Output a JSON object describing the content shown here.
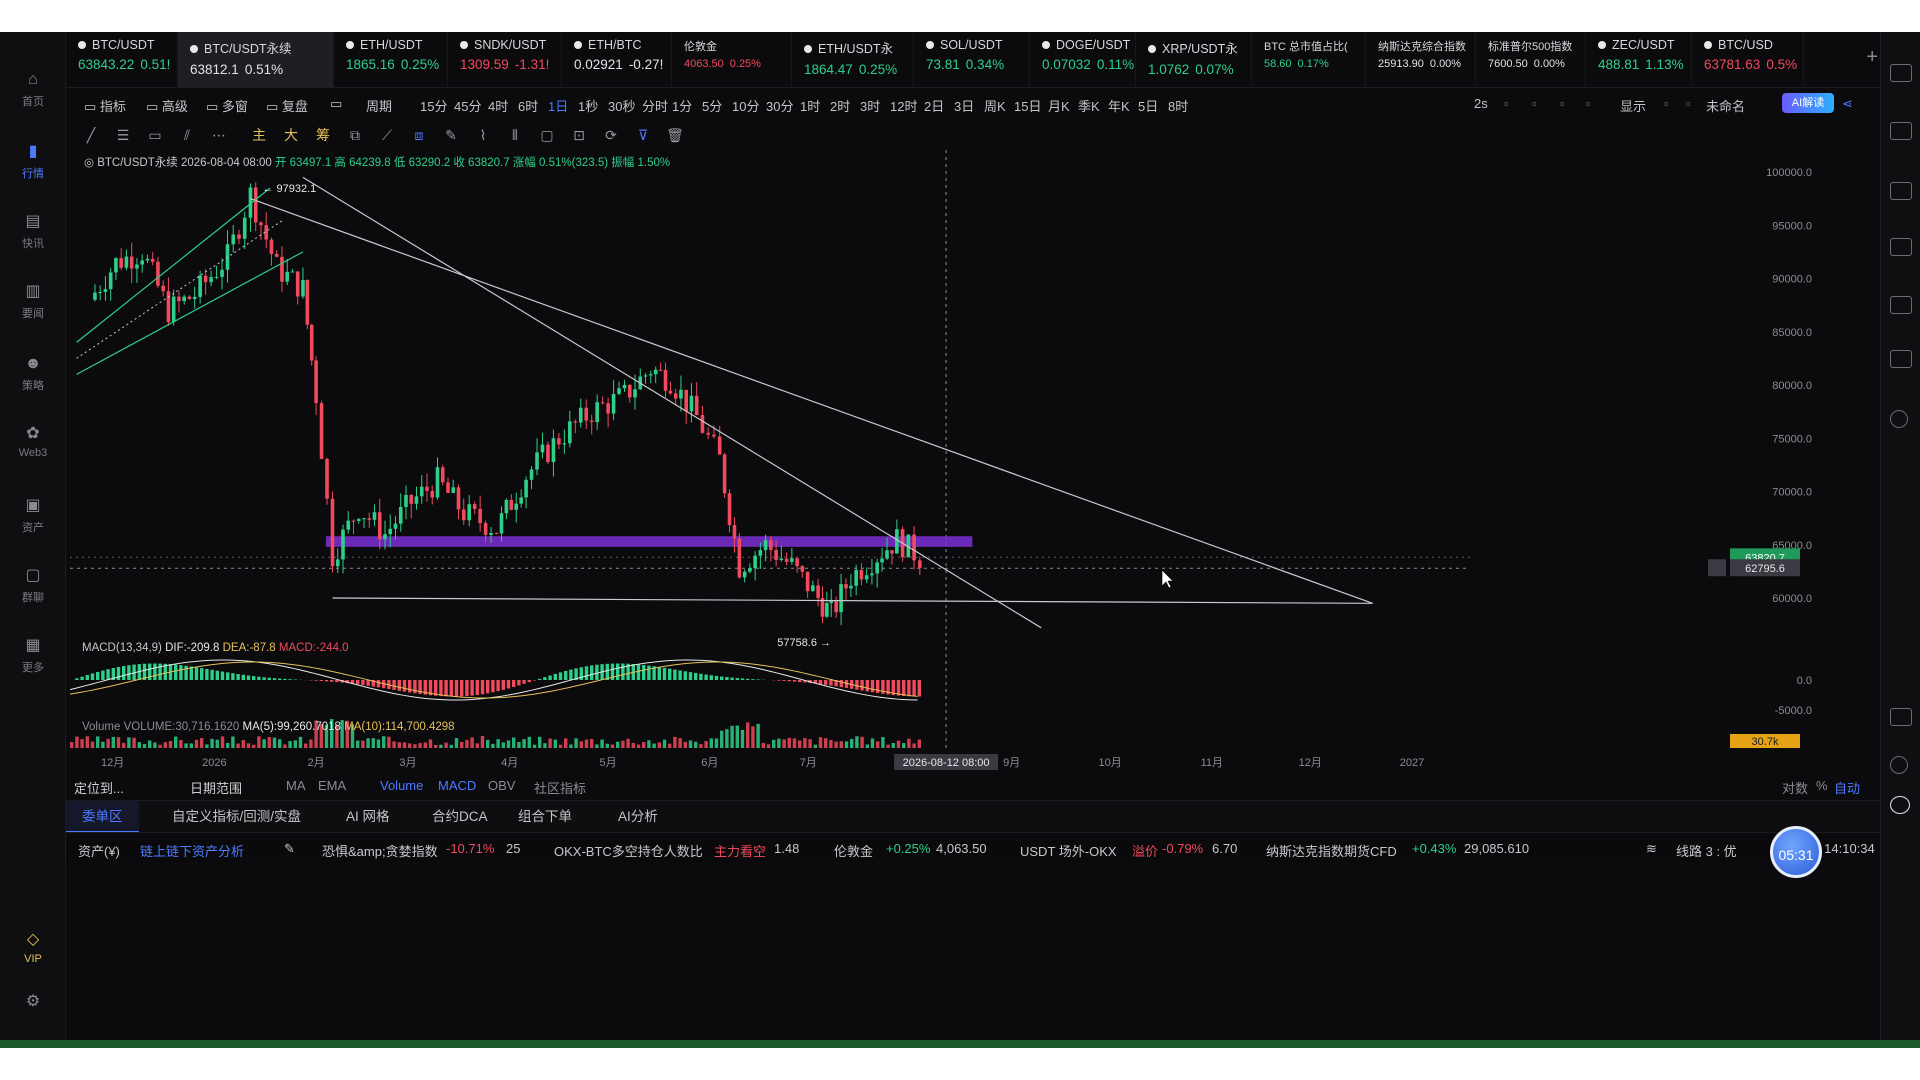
{
  "sidebar": {
    "items": [
      {
        "label": "首页",
        "icon": "home-icon"
      },
      {
        "label": "行情",
        "icon": "chart-bars-icon"
      },
      {
        "label": "快讯",
        "icon": "news-icon"
      },
      {
        "label": "要闻",
        "icon": "document-icon"
      },
      {
        "label": "策略",
        "icon": "robot-icon"
      },
      {
        "label": "Web3",
        "icon": "web3-icon"
      },
      {
        "label": "资产",
        "icon": "wallet-icon"
      },
      {
        "label": "群聊",
        "icon": "chat-icon"
      },
      {
        "label": "更多",
        "icon": "grid-icon"
      }
    ],
    "vip_label": "VIP",
    "settings_icon": "settings-icon"
  },
  "tickers": [
    {
      "name": "BTC/USDT",
      "price": "63843.22",
      "change": "0.51!",
      "dir": "up"
    },
    {
      "name": "BTC/USDT永续",
      "price": "63812.1",
      "change": "0.51%",
      "dir": "up",
      "selected": true
    },
    {
      "name": "ETH/USDT",
      "price": "1865.16",
      "change": "0.25%",
      "dir": "up"
    },
    {
      "name": "SNDK/USDT",
      "price": "1309.59",
      "change": "-1.31!",
      "dir": "dn"
    },
    {
      "name": "ETH/BTC",
      "price": "0.02921",
      "change": "-0.27!",
      "dir": "wh"
    },
    {
      "name": "伦敦金",
      "price": "4063.50",
      "change": "0.25%",
      "dir": "dn",
      "small": true
    },
    {
      "name": "ETH/USDT永",
      "price": "1864.47",
      "change": "0.25%",
      "dir": "up"
    },
    {
      "name": "SOL/USDT",
      "price": "73.81",
      "change": "0.34%",
      "dir": "up"
    },
    {
      "name": "DOGE/USDT",
      "price": "0.07032",
      "change": "0.11%",
      "dir": "up"
    },
    {
      "name": "XRP/USDT永",
      "price": "1.0762",
      "change": "0.07%",
      "dir": "up"
    },
    {
      "name": "BTC 总市值占比(",
      "price": "58.60",
      "change": "0.17%",
      "dir": "up",
      "small": true
    },
    {
      "name": "纳斯达克综合指数",
      "price": "25913.90",
      "change": "0.00%",
      "dir": "wh",
      "small": true
    },
    {
      "name": "标准普尔500指数",
      "price": "7600.50",
      "change": "0.00%",
      "dir": "wh",
      "small": true
    },
    {
      "name": "ZEC/USDT",
      "price": "488.81",
      "change": "1.13%",
      "dir": "up"
    },
    {
      "name": "BTC/USD",
      "price": "63781.63",
      "change": "0.5%",
      "dir": "dn"
    }
  ],
  "toolbar": {
    "left": [
      "指标",
      "高级",
      "多窗",
      "复盘",
      "",
      "周期"
    ],
    "periods": [
      "15分",
      "45分",
      "4时",
      "6时",
      "1日",
      "1秒",
      "30秒",
      "分时",
      "1分",
      "5分",
      "10分",
      "30分",
      "1时",
      "2时",
      "3时",
      "12时",
      "2日",
      "3日",
      "周K",
      "15日",
      "月K",
      "季K",
      "年K",
      "5日",
      "8时"
    ],
    "active_period": "1日",
    "right": [
      "2s",
      "显示",
      "未命名"
    ],
    "ai_label": "AI解读"
  },
  "drawbar": {
    "icons": [
      "trend-line-icon",
      "horizontal-lines-icon",
      "rectangle-icon",
      "pencil-icon",
      "more-icon",
      "main-icon",
      "big-icon",
      "chip-icon",
      "copy-icon",
      "measure-icon",
      "layers-icon",
      "eraser-icon",
      "brush-icon",
      "bars-icon",
      "clipboard-icon",
      "edit-icon",
      "rotate-icon",
      "filter-icon",
      "trash-icon"
    ],
    "text_items": [
      "主",
      "大",
      "筹"
    ]
  },
  "chart_info": {
    "symbol": "BTC/USDT永续",
    "date": "2026-08-04 08:00",
    "open": "开 63497.1",
    "high": "高 64239.8",
    "low": "低 63290.2",
    "close": "收 63820.7",
    "change": "涨幅 0.51%(323.5)",
    "amplitude": "振幅 1.50%"
  },
  "chart_data": {
    "type": "candlestick",
    "y_ticks": [
      "100000.0",
      "95000.0",
      "90000.0",
      "85000.0",
      "80000.0",
      "75000.0",
      "70000.0",
      "65000.0",
      "60000.0"
    ],
    "y_ticks_values": [
      100000,
      95000,
      90000,
      85000,
      80000,
      75000,
      70000,
      65000,
      60000
    ],
    "x_ticks": [
      "12月",
      "2026",
      "2月",
      "3月",
      "4月",
      "5月",
      "6月",
      "7月",
      "8月",
      "9月",
      "10月",
      "11月",
      "12月",
      "2027"
    ],
    "annotations": {
      "high": "97932.1",
      "low": "57758.6"
    },
    "last_price_label": "63820.7",
    "cursor_price_label": "62795.6",
    "cursor_date_label": "2026-08-12 08:00",
    "resistance_zone": [
      64800,
      65800
    ],
    "close_path": [
      {
        "t": "2025-11-24",
        "p": 88000
      },
      {
        "t": "2025-12-02",
        "p": 91500
      },
      {
        "t": "2025-12-10",
        "p": 92500
      },
      {
        "t": "2025-12-18",
        "p": 87000
      },
      {
        "t": "2025-12-26",
        "p": 88500
      },
      {
        "t": "2026-01-05",
        "p": 92000
      },
      {
        "t": "2026-01-12",
        "p": 97932
      },
      {
        "t": "2026-01-20",
        "p": 91000
      },
      {
        "t": "2026-01-28",
        "p": 89000
      },
      {
        "t": "2026-02-01",
        "p": 79000
      },
      {
        "t": "2026-02-06",
        "p": 64000
      },
      {
        "t": "2026-02-14",
        "p": 68500
      },
      {
        "t": "2026-02-22",
        "p": 66000
      },
      {
        "t": "2026-03-02",
        "p": 69000
      },
      {
        "t": "2026-03-10",
        "p": 71000
      },
      {
        "t": "2026-03-18",
        "p": 68000
      },
      {
        "t": "2026-03-28",
        "p": 66500
      },
      {
        "t": "2026-04-06",
        "p": 71500
      },
      {
        "t": "2026-04-16",
        "p": 75000
      },
      {
        "t": "2026-04-26",
        "p": 77500
      },
      {
        "t": "2026-05-06",
        "p": 79000
      },
      {
        "t": "2026-05-14",
        "p": 81500
      },
      {
        "t": "2026-05-20",
        "p": 80500
      },
      {
        "t": "2026-05-28",
        "p": 77000
      },
      {
        "t": "2026-06-04",
        "p": 73000
      },
      {
        "t": "2026-06-10",
        "p": 63000
      },
      {
        "t": "2026-06-18",
        "p": 65000
      },
      {
        "t": "2026-06-26",
        "p": 63000
      },
      {
        "t": "2026-07-04",
        "p": 60000
      },
      {
        "t": "2026-07-08",
        "p": 58500
      },
      {
        "t": "2026-07-14",
        "p": 62000
      },
      {
        "t": "2026-07-22",
        "p": 64000
      },
      {
        "t": "2026-07-28",
        "p": 65500
      },
      {
        "t": "2026-08-04",
        "p": 63820
      }
    ],
    "trendlines": [
      {
        "from": {
          "t": "2026-01-12",
          "p": 97500
        },
        "to": {
          "t": "2026-12-20",
          "p": 59500
        }
      },
      {
        "from": {
          "t": "2026-01-28",
          "p": 99500
        },
        "to": {
          "t": "2026-09-10",
          "p": 57200
        }
      },
      {
        "from": {
          "t": "2026-02-06",
          "p": 60000
        },
        "to": {
          "t": "2026-12-20",
          "p": 59500
        }
      },
      {
        "from": {
          "t": "2025-11-20",
          "p": 84000
        },
        "to": {
          "t": "2026-01-18",
          "p": 98500
        }
      },
      {
        "from": {
          "t": "2025-11-20",
          "p": 81000
        },
        "to": {
          "t": "2026-01-28",
          "p": 92500
        }
      }
    ],
    "macd": {
      "params": "MACD(13,34,9)",
      "dif": "DIF:-209.8",
      "dea": "DEA:-87.8",
      "macd": "MACD:-244.0",
      "y_ticks": [
        "0.0",
        "-5000.0"
      ]
    },
    "volume": {
      "label": "Volume",
      "value": "VOLUME:30,716.1620",
      "ma5": "MA(5):99,260.7018",
      "ma10": "MA(10):114,700.4298",
      "last_label": "30.7k"
    }
  },
  "indicator_row": {
    "items": [
      "定位到...",
      "日期范围",
      "MA",
      "EMA",
      "Volume",
      "MACD",
      "OBV",
      "社区指标"
    ],
    "active": [
      "Volume",
      "MACD"
    ],
    "right": [
      "对数",
      "%",
      "自动"
    ]
  },
  "bottom_tabs": {
    "items": [
      "委单区",
      "自定义指标/回测/实盘",
      "AI 网格",
      "合约DCA",
      "组合下单",
      "AI分析"
    ],
    "active": "委单区"
  },
  "statusbar": {
    "assets": "资产(¥)",
    "onchain": "链上链下资产分析",
    "fear_label": "恐惧&amp;贪婪指数",
    "fear_change": "-10.71%",
    "fear_value": "25",
    "okx_label": "OKX-BTC多空持仓人数比",
    "okx_tag": "主力看空",
    "okx_value": "1.48",
    "gold_label": "伦敦金",
    "gold_change": "+0.25%",
    "gold_value": "4,063.50",
    "usdt_label": "USDT 场外-OKX",
    "usdt_tag": "溢价",
    "usdt_change": "-0.79%",
    "usdt_value": "6.70",
    "nasdaq_label": "纳斯达克指数期货CFD",
    "nasdaq_change": "+0.43%",
    "nasdaq_value": "29,085.610",
    "line_label": "线路 3 : 优",
    "time": "08/04 14:10:34"
  },
  "timer": "05:31",
  "colors": {
    "up": "#2ecf8a",
    "down": "#f04a5c",
    "accent": "#4c7bff",
    "zone": "#7b2fd6"
  }
}
